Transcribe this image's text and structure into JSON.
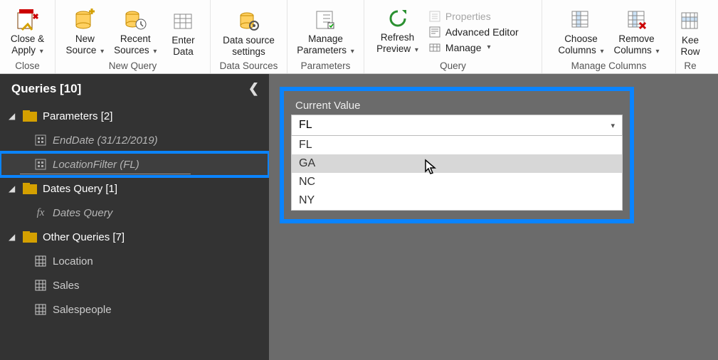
{
  "ribbon": {
    "close_apply": "Close &\nApply",
    "new_source": "New\nSource",
    "recent_sources": "Recent\nSources",
    "enter_data": "Enter\nData",
    "data_source_settings": "Data source\nsettings",
    "manage_parameters": "Manage\nParameters",
    "refresh_preview": "Refresh\nPreview",
    "properties": "Properties",
    "advanced_editor": "Advanced Editor",
    "manage": "Manage",
    "choose_columns": "Choose\nColumns",
    "remove_columns": "Remove\nColumns",
    "keep_rows": "Kee\nRow",
    "grp_close": "Close",
    "grp_newquery": "New Query",
    "grp_datasources": "Data Sources",
    "grp_parameters": "Parameters",
    "grp_query": "Query",
    "grp_managecols": "Manage Columns",
    "grp_reducerows": "Re"
  },
  "sidebar": {
    "title": "Queries [10]",
    "parameters_group": "Parameters [2]",
    "enddate": "EndDate (31/12/2019)",
    "locationfilter": "LocationFilter (FL)",
    "dates_group": "Dates Query [1]",
    "dates_query": "Dates Query",
    "other_group": "Other Queries [7]",
    "q_location": "Location",
    "q_sales": "Sales",
    "q_salespeople": "Salespeople"
  },
  "param": {
    "label": "Current Value",
    "value": "FL",
    "options": [
      "FL",
      "GA",
      "NC",
      "NY"
    ],
    "hover_index": 1
  }
}
